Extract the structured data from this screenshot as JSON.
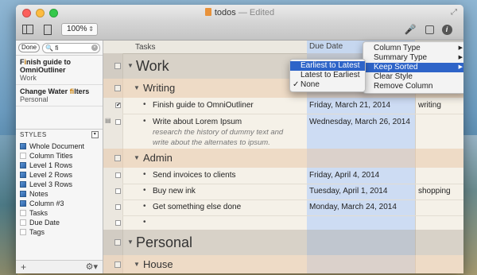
{
  "window": {
    "title": "todos",
    "status": "— Edited"
  },
  "toolbar": {
    "zoom": "100%",
    "icons": [
      "sidebar-icon",
      "document-icon",
      "microphone-icon",
      "save-icon",
      "info-icon"
    ]
  },
  "sidebar": {
    "done_label": "Done",
    "search_value": "fi",
    "results": [
      {
        "prefix": "F",
        "highlight": "i",
        "rest": "nish guide to OmniOutliner",
        "section": "Work"
      },
      {
        "prefix": "Change Water ",
        "highlight": "fi",
        "rest": "lters",
        "section": "Personal"
      }
    ],
    "styles_header": "STYLES",
    "styles": [
      {
        "label": "Whole Document",
        "icon": "blue"
      },
      {
        "label": "Column Titles",
        "icon": "plain"
      },
      {
        "label": "Level 1 Rows",
        "icon": "blue"
      },
      {
        "label": "Level 2 Rows",
        "icon": "blue"
      },
      {
        "label": "Level 3 Rows",
        "icon": "blue"
      },
      {
        "label": "Notes",
        "icon": "blue"
      },
      {
        "label": "Column #3",
        "icon": "blue"
      },
      {
        "label": "Tasks",
        "icon": "plain"
      },
      {
        "label": "Due Date",
        "icon": "plain"
      },
      {
        "label": "Tags",
        "icon": "plain"
      }
    ],
    "add_icon": "plus-icon",
    "settings_icon": "gear-icon"
  },
  "outline": {
    "col_tasks": "Tasks",
    "col_due": "Due Date",
    "rows": {
      "work": "Work",
      "writing": "Writing",
      "finish": {
        "text": "Finish guide to OmniOutliner",
        "date": "Friday, March 21, 2014",
        "ctx": "writing",
        "checked": "✔"
      },
      "lorem": {
        "text": "Write about Lorem Ipsum",
        "date": "Wednesday, March 26, 2014",
        "note": "research the history of dummy text and write about the alternates to ipsum."
      },
      "admin": "Admin",
      "invoices": {
        "text": "Send invoices to clients",
        "date": "Friday, April 4, 2014"
      },
      "ink": {
        "text": "Buy new ink",
        "date": "Tuesday, April 1, 2014",
        "ctx": "shopping"
      },
      "else": {
        "text": "Get something else done",
        "date": "Monday, March 24, 2014"
      },
      "personal": "Personal",
      "house": "House"
    }
  },
  "column_menu": {
    "items": [
      "Column Type",
      "Summary Type",
      "Keep Sorted",
      "Clear Style",
      "Remove Column"
    ],
    "selected": "Keep Sorted"
  },
  "sort_submenu": {
    "items": [
      "Earliest to Latest",
      "Latest to Earliest",
      "None"
    ],
    "highlighted": "Earliest to Latest",
    "checked": "None",
    "check_mark": "✓"
  }
}
